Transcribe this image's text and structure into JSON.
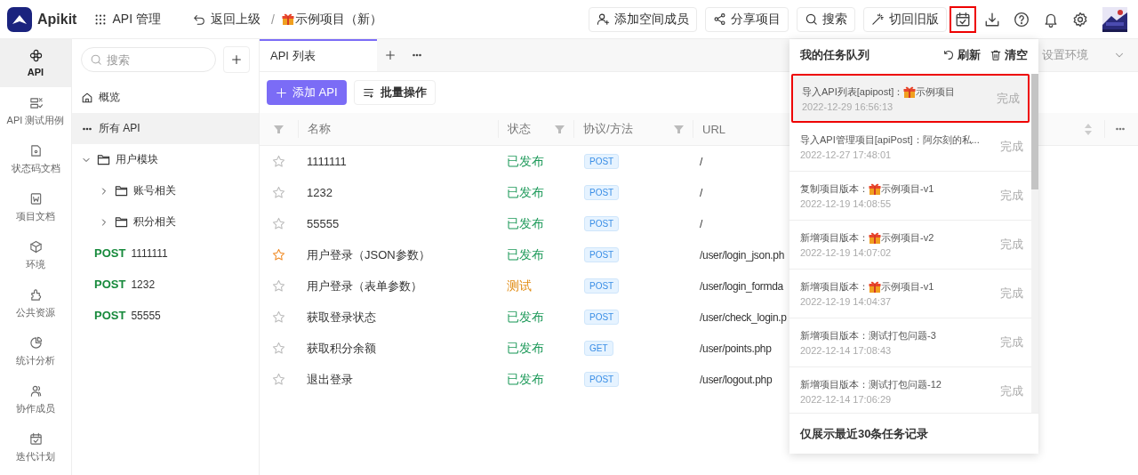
{
  "header": {
    "brand": "Apikit",
    "menu": "API 管理",
    "back": "返回上级",
    "separator": "/",
    "project": {
      "gift": true,
      "name": "示例项目（新）"
    },
    "actions": [
      "添加空间成员",
      "分享项目",
      "搜索",
      "切回旧版"
    ],
    "tools": [
      {
        "highlighted": true
      },
      {
        "highlighted": false
      },
      {
        "highlighted": false
      },
      {
        "highlighted": false
      },
      {
        "highlighted": false
      }
    ]
  },
  "rail": [
    {
      "label": "API",
      "selected": true
    },
    {
      "label": "API 测试用例",
      "selected": false
    },
    {
      "label": "状态码文档",
      "selected": false
    },
    {
      "label": "项目文档",
      "selected": false
    },
    {
      "label": "环境",
      "selected": false
    },
    {
      "label": "公共资源",
      "selected": false
    },
    {
      "label": "统计分析",
      "selected": false
    },
    {
      "label": "协作成员",
      "selected": false
    },
    {
      "label": "迭代计划",
      "selected": false
    }
  ],
  "tree": {
    "search_placeholder": "搜索",
    "items": [
      {
        "kind": "home",
        "label": "概览",
        "selected": false
      },
      {
        "kind": "all",
        "label": "所有 API",
        "selected": true
      },
      {
        "kind": "folder",
        "label": "用户模块",
        "selected": false,
        "expanded": true,
        "children": [
          {
            "kind": "folder",
            "label": "账号相关",
            "selected": false,
            "expanded": false
          },
          {
            "kind": "folder",
            "label": "积分相关",
            "selected": false,
            "expanded": false
          }
        ]
      },
      {
        "kind": "api",
        "method": "POST",
        "label": "1111111",
        "selected": false
      },
      {
        "kind": "api",
        "method": "POST",
        "label": "1232",
        "selected": false
      },
      {
        "kind": "api",
        "method": "POST",
        "label": "55555",
        "selected": false
      }
    ]
  },
  "tabs": [
    {
      "label": "API 列表",
      "selected": true
    }
  ],
  "environment": {
    "placeholder": "设置环境"
  },
  "toolbar": {
    "add": "添加 API",
    "batch": "批量操作"
  },
  "table": {
    "columns": [
      "名称",
      "状态",
      "协议/方法",
      "URL"
    ],
    "rows": [
      {
        "starred": false,
        "name": "1111111",
        "status": "已发布",
        "color": "#1e9a5a",
        "method": "POST",
        "url": "/"
      },
      {
        "starred": false,
        "name": "1232",
        "status": "已发布",
        "color": "#1e9a5a",
        "method": "POST",
        "url": "/"
      },
      {
        "starred": false,
        "name": "55555",
        "status": "已发布",
        "color": "#1e9a5a",
        "method": "POST",
        "url": "/"
      },
      {
        "starred": true,
        "name": "用户登录（JSON参数）",
        "status": "已发布",
        "color": "#1e9a5a",
        "method": "POST",
        "url": "/user/login_json.ph"
      },
      {
        "starred": false,
        "name": "用户登录（表单参数）",
        "status": "测试",
        "color": "#e08a10",
        "method": "POST",
        "url": "/user/login_formda"
      },
      {
        "starred": false,
        "name": "获取登录状态",
        "status": "已发布",
        "color": "#1e9a5a",
        "method": "POST",
        "url": "/user/check_login.p"
      },
      {
        "starred": false,
        "name": "获取积分余额",
        "status": "已发布",
        "color": "#1e9a5a",
        "method": "GET",
        "url": "/user/points.php"
      },
      {
        "starred": false,
        "name": "退出登录",
        "status": "已发布",
        "color": "#1e9a5a",
        "method": "POST",
        "url": "/user/logout.php"
      }
    ]
  },
  "task_queue": {
    "title": "我的任务队列",
    "refresh": "刷新",
    "clear": "清空",
    "footer": "仅展示最近30条任务记录",
    "items": [
      {
        "title": "导入API列表[apipost]：",
        "gift": true,
        "project": "示例项目",
        "time": "2022-12-29 16:56:13",
        "status": "完成",
        "highlighted": true
      },
      {
        "title": "导入API管理项目[apiPost]：阿尔刻的私...",
        "gift": false,
        "time": "2022-12-27 17:48:01",
        "status": "完成",
        "highlighted": false
      },
      {
        "title": "复制项目版本：",
        "gift": true,
        "project": "示例项目-v1",
        "time": "2022-12-19 14:08:55",
        "status": "完成",
        "highlighted": false
      },
      {
        "title": "新增项目版本：",
        "gift": true,
        "project": "示例项目-v2",
        "time": "2022-12-19 14:07:02",
        "status": "完成",
        "highlighted": false
      },
      {
        "title": "新增项目版本：",
        "gift": true,
        "project": "示例项目-v1",
        "time": "2022-12-19 14:04:37",
        "status": "完成",
        "highlighted": false
      },
      {
        "title": "新增项目版本：测试打包问题-3",
        "gift": false,
        "time": "2022-12-14 17:08:43",
        "status": "完成",
        "highlighted": false
      },
      {
        "title": "新增项目版本：测试打包问题-12",
        "gift": false,
        "time": "2022-12-14 17:06:29",
        "status": "完成",
        "highlighted": false
      }
    ]
  }
}
